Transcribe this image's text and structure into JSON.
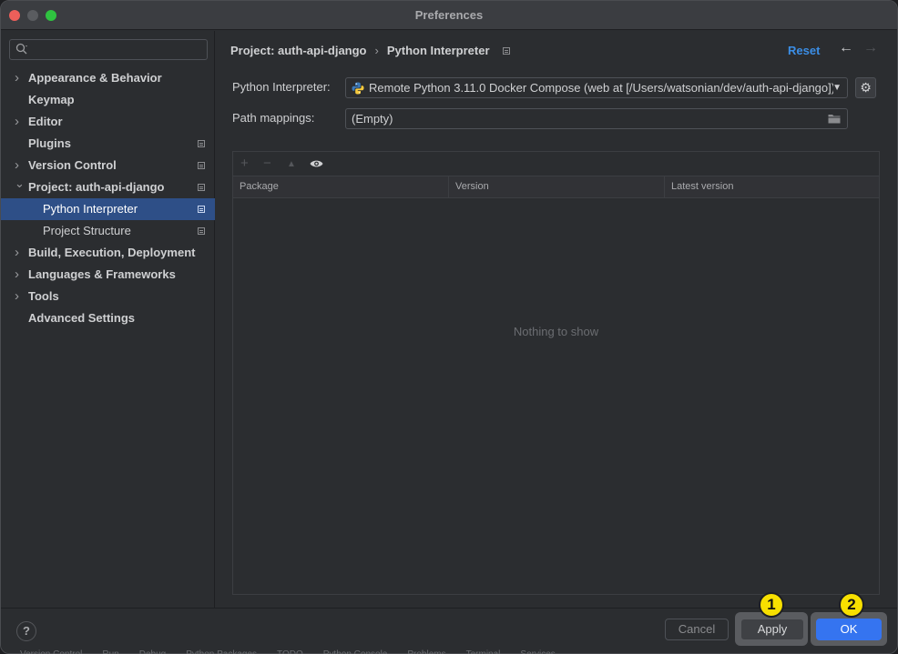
{
  "window": {
    "title": "Preferences"
  },
  "sidebar": {
    "search": {
      "placeholder": ""
    },
    "items": [
      {
        "label": "Appearance & Behavior",
        "chevron": "right",
        "pin": false,
        "child": false,
        "selected": false
      },
      {
        "label": "Keymap",
        "chevron": "",
        "pin": false,
        "child": false,
        "selected": false
      },
      {
        "label": "Editor",
        "chevron": "right",
        "pin": false,
        "child": false,
        "selected": false
      },
      {
        "label": "Plugins",
        "chevron": "",
        "pin": true,
        "child": false,
        "selected": false
      },
      {
        "label": "Version Control",
        "chevron": "right",
        "pin": true,
        "child": false,
        "selected": false
      },
      {
        "label": "Project: auth-api-django",
        "chevron": "down",
        "pin": true,
        "child": false,
        "selected": false
      },
      {
        "label": "Python Interpreter",
        "chevron": "",
        "pin": true,
        "child": true,
        "selected": true
      },
      {
        "label": "Project Structure",
        "chevron": "",
        "pin": true,
        "child": true,
        "selected": false
      },
      {
        "label": "Build, Execution, Deployment",
        "chevron": "right",
        "pin": false,
        "child": false,
        "selected": false
      },
      {
        "label": "Languages & Frameworks",
        "chevron": "right",
        "pin": false,
        "child": false,
        "selected": false
      },
      {
        "label": "Tools",
        "chevron": "right",
        "pin": false,
        "child": false,
        "selected": false
      },
      {
        "label": "Advanced Settings",
        "chevron": "",
        "pin": false,
        "child": false,
        "selected": false
      }
    ]
  },
  "header": {
    "breadcrumb_project": "Project: auth-api-django",
    "breadcrumb_separator": "›",
    "breadcrumb_page": "Python Interpreter",
    "reset_label": "Reset",
    "back_icon": "arrow-left-icon",
    "forward_icon": "arrow-right-icon"
  },
  "interpreter": {
    "label": "Python Interpreter:",
    "value": "Remote Python 3.11.0 Docker Compose (web at [/Users/watsonian/dev/auth-api-django])",
    "icon": "python-icon"
  },
  "path_mappings": {
    "label": "Path mappings:",
    "value": "(Empty)"
  },
  "packages": {
    "toolbar": {
      "add": "+",
      "remove": "−",
      "upgrade": "▲",
      "show": "eye-icon"
    },
    "columns": [
      "Package",
      "Version",
      "Latest version"
    ],
    "rows": [],
    "empty_text": "Nothing to show"
  },
  "footer": {
    "help_label": "?",
    "cancel_label": "Cancel",
    "apply_label": "Apply",
    "ok_label": "OK",
    "apply_badge": "1",
    "ok_badge": "2"
  },
  "colors": {
    "accent": "#3574f0",
    "selection": "#2e4f87",
    "link": "#3b8ee6",
    "badge": "#f8e000"
  },
  "underlay": [
    "Version Control",
    "Run",
    "Debug",
    "Python Packages",
    "TODO",
    "Python Console",
    "Problems",
    "Terminal",
    "Services"
  ]
}
